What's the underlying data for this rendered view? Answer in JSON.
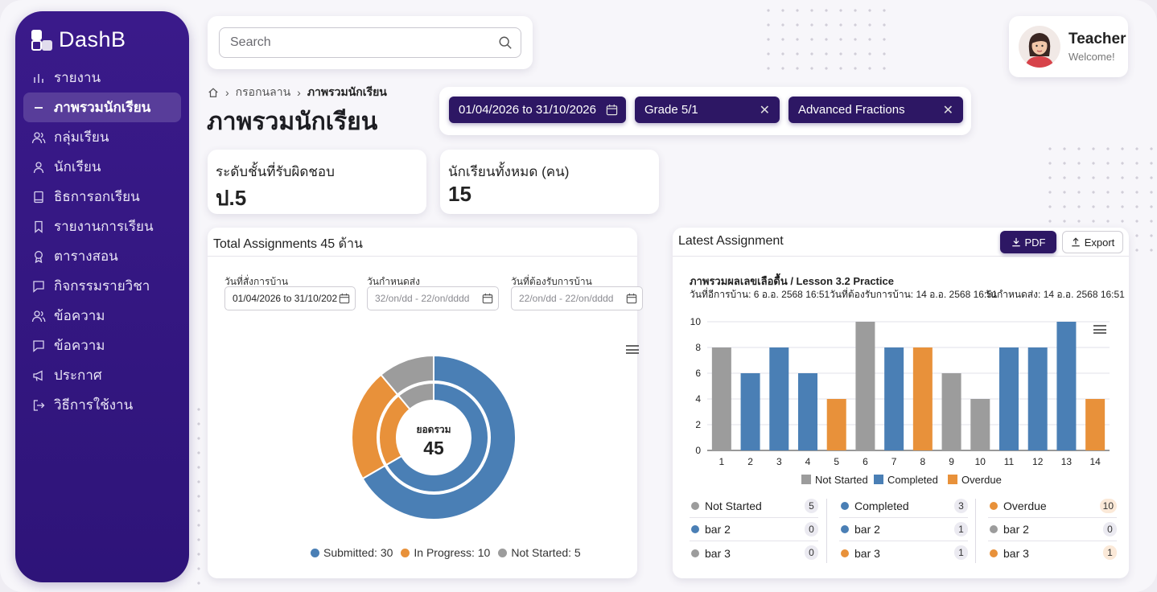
{
  "app": {
    "logo_text": "DashB"
  },
  "sidebar": {
    "items": [
      {
        "label": "รายงาน",
        "icon": "bar-chart-icon",
        "active": false
      },
      {
        "label": "ภาพรวมนักเรียน",
        "icon": "dash-icon",
        "active": true
      },
      {
        "label": "กลุ่มเรียน",
        "icon": "users-icon",
        "active": false
      },
      {
        "label": "นักเรียน",
        "icon": "user-icon",
        "active": false
      },
      {
        "label": "ธิธการอกเรียน",
        "icon": "book-icon",
        "active": false
      },
      {
        "label": "รายงานการเรียน",
        "icon": "bookmark-icon",
        "active": false
      },
      {
        "label": "ตารางสอน",
        "icon": "award-icon",
        "active": false
      },
      {
        "label": "กิจกรรมรายวิชา",
        "icon": "chat-icon",
        "active": false
      },
      {
        "label": "ข้อความ",
        "icon": "users-icon",
        "active": false
      },
      {
        "label": "ข้อความ",
        "icon": "chat-icon",
        "active": false
      },
      {
        "label": "ประกาศ",
        "icon": "megaphone-icon",
        "active": false
      },
      {
        "label": "วิธีการใช้งาน",
        "icon": "logout-icon",
        "active": false
      }
    ]
  },
  "search": {
    "placeholder": "Search"
  },
  "profile": {
    "name": "Teacher",
    "subtitle": "Welcome!"
  },
  "breadcrumb": {
    "middle": "กรอกนลาน",
    "current": "ภาพรวมนักเรียน"
  },
  "page": {
    "title": "ภาพรวมนักเรียน"
  },
  "filters": {
    "date_range": "01/04/2026 to 31/10/2026",
    "grade": "Grade 5/1",
    "topic": "Advanced Fractions"
  },
  "stats": [
    {
      "label": "ระดับชั้นที่รับผิดชอบ",
      "value": "ป.5"
    },
    {
      "label": "นักเรียนทั้งหมด (คน)",
      "value": "15"
    }
  ],
  "assign_panel": {
    "title": "Total Assignments 45 ด้าน",
    "date1_label": "วันที่สั่งการบ้าน",
    "date1_value": "01/04/2026 to 31/10/202",
    "date2_label": "วันกำหนดส่ง",
    "date2_placeholder": "32/on/dd - 22/on/dddd",
    "date3_label": "วันที่ต้องรับการบ้าน",
    "date3_placeholder": "22/on/dd - 22/on/dddd",
    "center_label": "ยอดรวม",
    "center_value": "45",
    "legend": [
      {
        "label": "Submitted: 30",
        "color": "#4a7fb5"
      },
      {
        "label": "In Progress: 10",
        "color": "#e8913a"
      },
      {
        "label": "Not Started: 5",
        "color": "#9c9c9c"
      }
    ]
  },
  "latest_panel": {
    "title": "Latest Assignment",
    "pdf_label": "PDF",
    "export_label": "Export",
    "subtitle": "ภาพรวมผลเลขเลือดื้น / Lesson 3.2 Practice",
    "meta1": "วันที่อีการบ้าน: 6 อ.อ. 2568 16:51",
    "meta2": "วันที่ต้องรับการบ้าน: 14 อ.อ. 2568 16:51",
    "meta3": "วันกำหนดส่ง: 14 อ.อ. 2568 16:51",
    "summary": [
      [
        {
          "label": "Not Started",
          "value": "5",
          "color": "#9c9c9c"
        },
        {
          "label": "bar 2",
          "value": "0",
          "color": "#4a7fb5"
        },
        {
          "label": "bar 3",
          "value": "0",
          "color": "#9c9c9c"
        }
      ],
      [
        {
          "label": "Completed",
          "value": "3",
          "color": "#4a7fb5"
        },
        {
          "label": "bar 2",
          "value": "1",
          "color": "#4a7fb5"
        },
        {
          "label": "bar 3",
          "value": "1",
          "color": "#e8913a"
        }
      ],
      [
        {
          "label": "Overdue",
          "value": "10",
          "color": "#e8913a"
        },
        {
          "label": "bar 2",
          "value": "0",
          "color": "#9c9c9c"
        },
        {
          "label": "bar 3",
          "value": "1",
          "color": "#e8913a"
        }
      ]
    ]
  },
  "chart_data": [
    {
      "type": "pie",
      "variant": "concentric-donut",
      "rings": 2,
      "center_label": "ยอดรวม",
      "center_value": 45,
      "slices": [
        {
          "name": "Submitted",
          "value": 30,
          "color": "#4a7fb5"
        },
        {
          "name": "In Progress",
          "value": 10,
          "color": "#e8913a"
        },
        {
          "name": "Not Started",
          "value": 5,
          "color": "#9c9c9c"
        }
      ],
      "legend_position": "bottom"
    },
    {
      "type": "bar",
      "categories": [
        "1",
        "2",
        "3",
        "4",
        "5",
        "6",
        "7",
        "8",
        "9",
        "10",
        "11",
        "12",
        "13",
        "14"
      ],
      "values": [
        8,
        6,
        8,
        6,
        4,
        10,
        8,
        8,
        6,
        4,
        8,
        8,
        10,
        4
      ],
      "status": [
        "Not Started",
        "Completed",
        "Completed",
        "Completed",
        "Overdue",
        "Not Started",
        "Completed",
        "Overdue",
        "Not Started",
        "Not Started",
        "Completed",
        "Completed",
        "Completed",
        "Overdue"
      ],
      "legend": [
        {
          "name": "Not Started",
          "color": "#9c9c9c"
        },
        {
          "name": "Completed",
          "color": "#4a7fb5"
        },
        {
          "name": "Overdue",
          "color": "#e8913a"
        }
      ],
      "yticks": [
        0,
        2,
        4,
        6,
        8,
        10
      ],
      "ylim": [
        0,
        10
      ],
      "grid": true,
      "legend_position": "bottom"
    }
  ]
}
